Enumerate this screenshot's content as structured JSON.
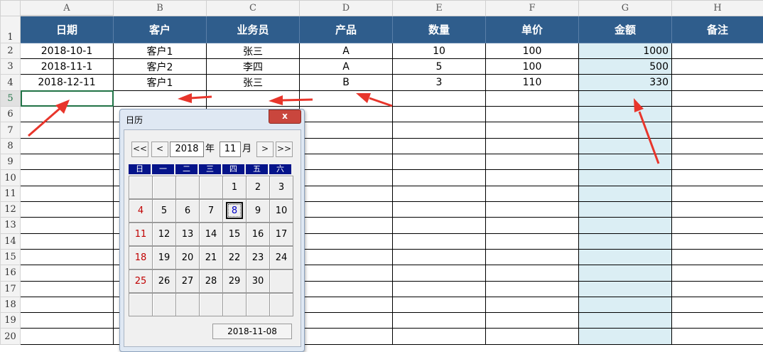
{
  "columns": [
    "A",
    "B",
    "C",
    "D",
    "E",
    "F",
    "G",
    "H"
  ],
  "headers": [
    "日期",
    "客户",
    "业务员",
    "产品",
    "数量",
    "单价",
    "金额",
    "备注"
  ],
  "rows": [
    [
      "2018-10-1",
      "客户1",
      "张三",
      "A",
      "10",
      "100",
      "1000",
      ""
    ],
    [
      "2018-11-1",
      "客户2",
      "李四",
      "A",
      "5",
      "100",
      "500",
      ""
    ],
    [
      "2018-12-11",
      "客户1",
      "张三",
      "B",
      "3",
      "110",
      "330",
      ""
    ]
  ],
  "row_numbers": [
    "1",
    "2",
    "3",
    "4",
    "5",
    "6",
    "7",
    "8",
    "9",
    "10",
    "11",
    "12",
    "13",
    "14",
    "15",
    "16",
    "17",
    "18",
    "19",
    "20"
  ],
  "selected_cell": "A5",
  "calendar": {
    "title": "日历",
    "close_label": "x",
    "nav": {
      "prev_year": "<<",
      "prev_month": "<",
      "next_month": ">",
      "next_year": ">>"
    },
    "year": "2018",
    "year_unit": "年",
    "month": "11",
    "month_unit": "月",
    "weekdays": [
      "日",
      "一",
      "二",
      "三",
      "四",
      "五",
      "六"
    ],
    "weeks": [
      [
        "",
        "",
        "",
        "",
        "1",
        "2",
        "3"
      ],
      [
        "4",
        "5",
        "6",
        "7",
        "8",
        "9",
        "10"
      ],
      [
        "11",
        "12",
        "13",
        "14",
        "15",
        "16",
        "17"
      ],
      [
        "18",
        "19",
        "20",
        "21",
        "22",
        "23",
        "24"
      ],
      [
        "25",
        "26",
        "27",
        "28",
        "29",
        "30",
        ""
      ],
      [
        "",
        "",
        "",
        "",
        "",
        "",
        ""
      ]
    ],
    "selected_day": "8",
    "selected_date": "2018-11-08"
  },
  "colors": {
    "header_bg": "#2f5d8c",
    "amount_col_bg": "#dbeef4",
    "arrow": "#e8352b",
    "weekday_bg": "#05148a",
    "sunday": "#c00000"
  }
}
